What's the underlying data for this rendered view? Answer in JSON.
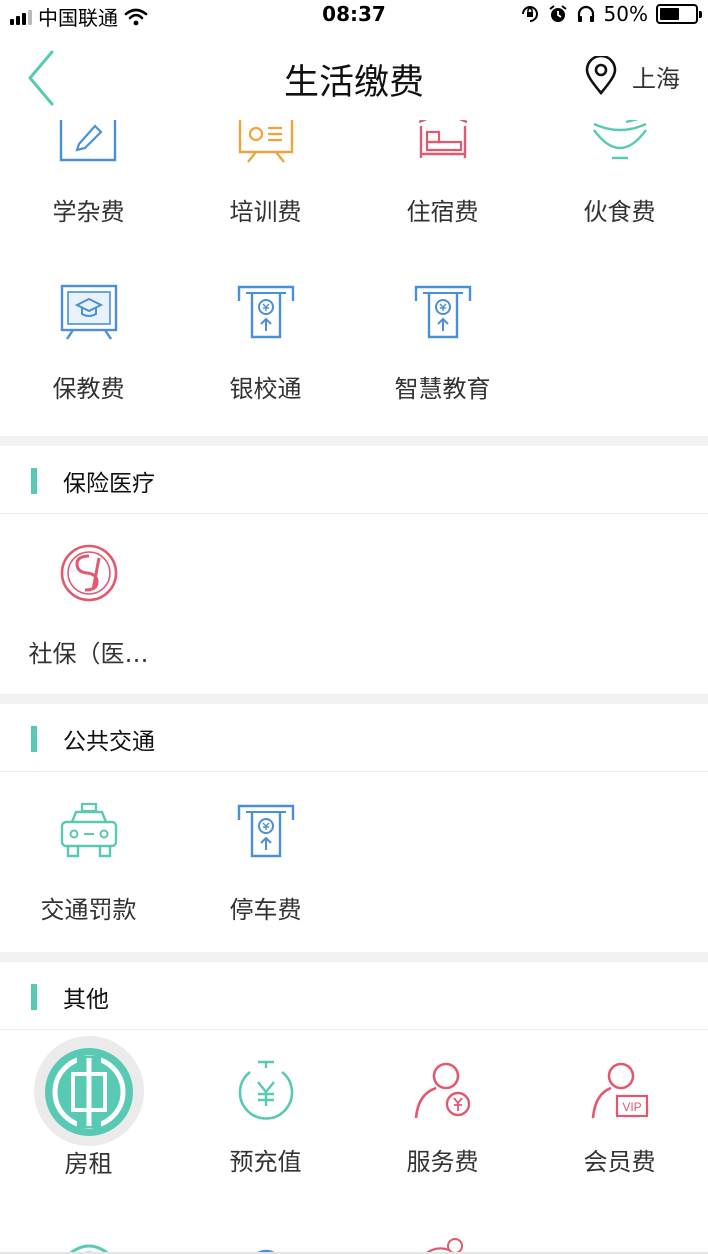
{
  "status": {
    "carrier": "中国联通",
    "time": "08:37",
    "battery": "50%"
  },
  "nav": {
    "title": "生活缴费",
    "city": "上海"
  },
  "education": {
    "items": [
      "学杂费",
      "培训费",
      "住宿费",
      "伙食费",
      "保教费",
      "银校通",
      "智慧教育"
    ]
  },
  "insurance": {
    "title": "保险医疗",
    "items": [
      "社保（医…"
    ]
  },
  "transport": {
    "title": "公共交通",
    "items": [
      "交通罚款",
      "停车费"
    ]
  },
  "other": {
    "title": "其他",
    "items": [
      "房租",
      "预充值",
      "服务费",
      "会员费"
    ]
  },
  "colors": {
    "accent": "#58c9b2",
    "blue": "#4a90d9",
    "pink": "#e2586f",
    "orange": "#f0a33c"
  }
}
